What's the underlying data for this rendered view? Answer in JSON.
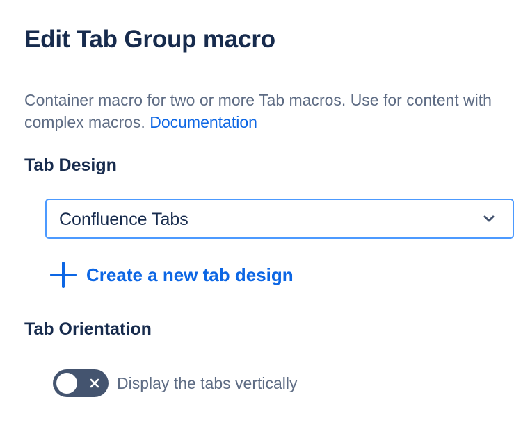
{
  "dialog": {
    "title": "Edit Tab Group macro",
    "description": "Container macro for two or more Tab macros. Use for content with complex macros.",
    "documentation_link": "Documentation"
  },
  "tab_design": {
    "label": "Tab Design",
    "selected_value": "Confluence Tabs",
    "chevron_icon": "chevron-down-icon",
    "create_link_icon": "plus-icon",
    "create_link_label": "Create a new tab design"
  },
  "tab_orientation": {
    "label": "Tab Orientation",
    "toggle_state": "off",
    "toggle_icon": "close-icon",
    "toggle_label": "Display the tabs vertically"
  },
  "colors": {
    "text_primary": "#172b4d",
    "text_secondary": "#5e6c84",
    "link": "#0c66e4",
    "focus_border": "#4c9aff",
    "toggle_off_bg": "#44546f"
  }
}
